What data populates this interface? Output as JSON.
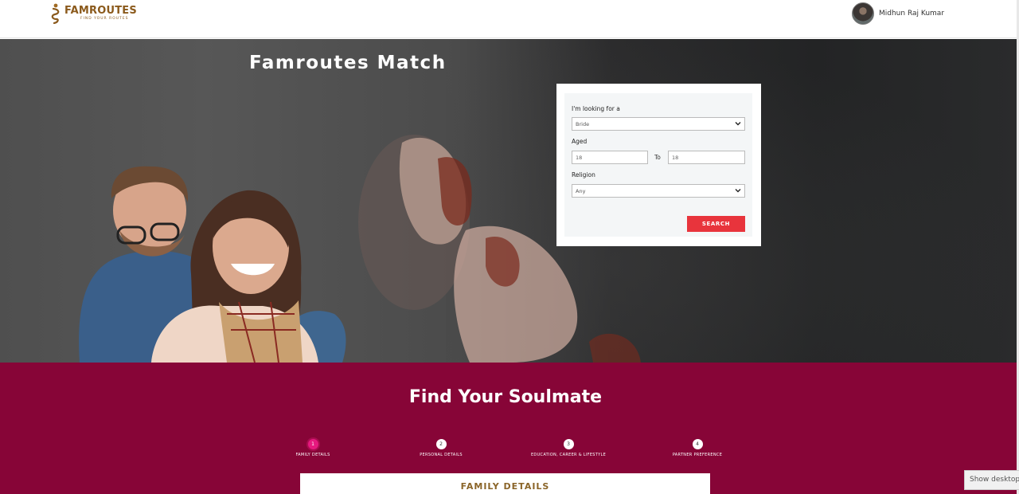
{
  "header": {
    "brand_name": "FAMROUTES",
    "brand_tagline": "FIND YOUR ROUTES",
    "user_name": "Midhun Raj Kumar"
  },
  "hero": {
    "title": "Famroutes Match"
  },
  "search": {
    "looking_for_label": "I'm looking for a",
    "looking_for_value": "Bride",
    "aged_label": "Aged",
    "age_from": "18",
    "to_label": "To",
    "age_to": "18",
    "religion_label": "Religion",
    "religion_value": "Any",
    "search_button": "SEARCH"
  },
  "soulmate": {
    "title": "Find Your Soulmate",
    "steps": [
      {
        "number": "1",
        "label": "FAMILY DETAILS",
        "active": true
      },
      {
        "number": "2",
        "label": "PERSONAL DETAILS",
        "active": false
      },
      {
        "number": "3",
        "label": "EDUCATION, CAREER & LIFESTYLE",
        "active": false
      },
      {
        "number": "4",
        "label": "PARTNER PREFERENCE",
        "active": false
      }
    ],
    "form_title": "FAMILY DETAILS"
  },
  "os": {
    "show_desktop": "Show desktop"
  },
  "colors": {
    "brand": "#8b5a1c",
    "soulmate_bg": "#870537",
    "search_button": "#e8343c",
    "active_step": "#e6197f"
  }
}
